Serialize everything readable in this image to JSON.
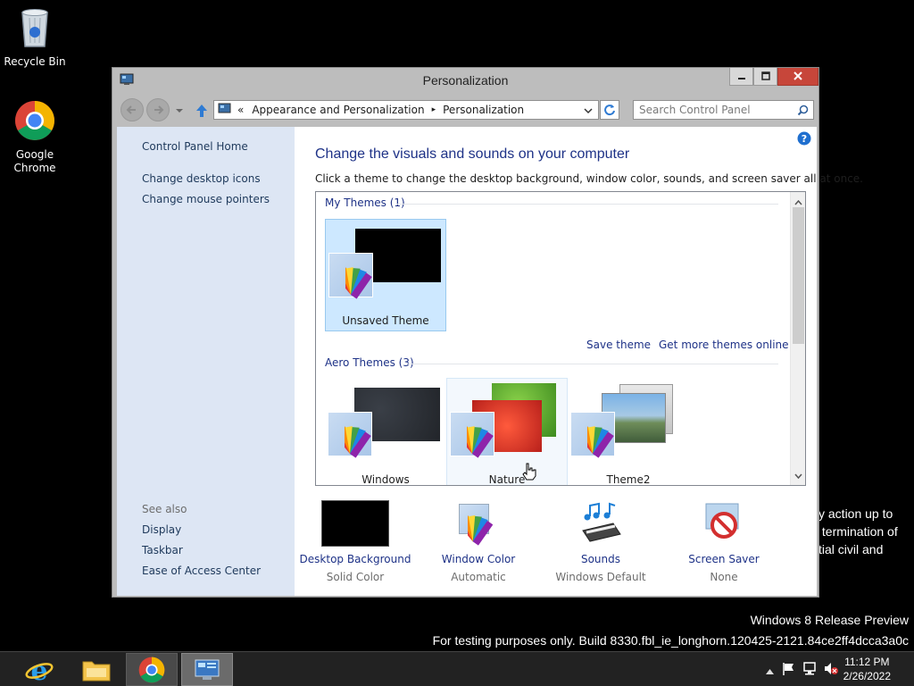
{
  "desktop": {
    "icons": [
      {
        "label": "Recycle Bin",
        "icon": "recycle-bin-icon"
      },
      {
        "label": "Google\nChrome",
        "icon": "chrome-icon"
      }
    ],
    "background_text": "y action up to\n termination of\ntial civil and",
    "watermark_line1": "Windows 8 Release Preview",
    "watermark_line2": "For testing purposes only. Build 8330.fbl_ie_longhorn.120425-2121.84ce2ff4dcca3a0c"
  },
  "window": {
    "title": "Personalization",
    "controls": {
      "minimize": "minimize-icon",
      "maximize": "maximize-icon",
      "close": "close-icon"
    }
  },
  "toolbar": {
    "breadcrumb_overflow": "«",
    "breadcrumb": [
      "Appearance and Personalization",
      "Personalization"
    ],
    "separator": "▸",
    "search_placeholder": "Search Control Panel"
  },
  "sidebar": {
    "home": "Control Panel Home",
    "links": [
      "Change desktop icons",
      "Change mouse pointers"
    ],
    "see_also_title": "See also",
    "see_also": [
      "Display",
      "Taskbar",
      "Ease of Access Center"
    ]
  },
  "main": {
    "heading": "Change the visuals and sounds on your computer",
    "description": "Click a theme to change the desktop background, window color, sounds, and screen saver all at once.",
    "my_themes_header": "My Themes (1)",
    "my_themes": [
      {
        "name": "Unsaved Theme",
        "selected": true
      }
    ],
    "save_theme": "Save theme",
    "get_more": "Get more themes online",
    "aero_themes_header": "Aero Themes (3)",
    "aero_themes": [
      {
        "name": "Windows"
      },
      {
        "name": "Nature"
      },
      {
        "name": "Theme2"
      }
    ]
  },
  "settings": [
    {
      "label": "Desktop Background",
      "value": "Solid Color"
    },
    {
      "label": "Window Color",
      "value": "Automatic"
    },
    {
      "label": "Sounds",
      "value": "Windows Default"
    },
    {
      "label": "Screen Saver",
      "value": "None"
    }
  ],
  "taskbar": {
    "time": "11:12 PM",
    "date": "2/26/2022"
  },
  "colors": {
    "link": "#1e3287",
    "sidebar_bg": "#dde6f4",
    "selected_tile": "#cde8ff",
    "close_button": "#c7463a"
  }
}
